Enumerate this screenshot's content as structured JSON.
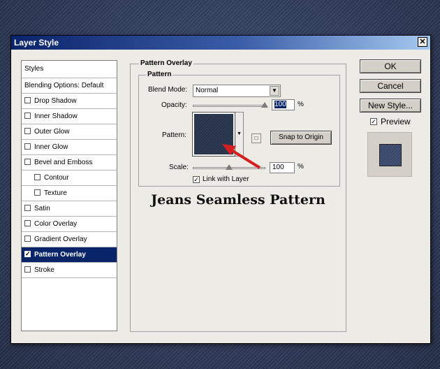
{
  "dialog": {
    "title": "Layer Style",
    "close_glyph": "✕"
  },
  "styles_list": {
    "items": [
      {
        "label": "Styles",
        "checkbox": false,
        "checked": false
      },
      {
        "label": "Blending Options: Default",
        "checkbox": false,
        "checked": false
      },
      {
        "label": "Drop Shadow",
        "checkbox": true,
        "checked": false
      },
      {
        "label": "Inner Shadow",
        "checkbox": true,
        "checked": false
      },
      {
        "label": "Outer Glow",
        "checkbox": true,
        "checked": false
      },
      {
        "label": "Inner Glow",
        "checkbox": true,
        "checked": false
      },
      {
        "label": "Bevel and Emboss",
        "checkbox": true,
        "checked": false
      },
      {
        "label": "Contour",
        "checkbox": true,
        "checked": false,
        "sub": true
      },
      {
        "label": "Texture",
        "checkbox": true,
        "checked": false,
        "sub": true
      },
      {
        "label": "Satin",
        "checkbox": true,
        "checked": false
      },
      {
        "label": "Color Overlay",
        "checkbox": true,
        "checked": false
      },
      {
        "label": "Gradient Overlay",
        "checkbox": true,
        "checked": false
      },
      {
        "label": "Pattern Overlay",
        "checkbox": true,
        "checked": true,
        "selected": true
      },
      {
        "label": "Stroke",
        "checkbox": true,
        "checked": false
      }
    ]
  },
  "pattern_overlay": {
    "group_title": "Pattern Overlay",
    "sub_group_title": "Pattern",
    "blend_mode_label": "Blend Mode:",
    "blend_mode_value": "Normal",
    "opacity_label": "Opacity:",
    "opacity_value": "100",
    "percent": "%",
    "pattern_label": "Pattern:",
    "snap_button": "Snap to Origin",
    "scale_label": "Scale:",
    "scale_value": "100",
    "link_label": "Link with Layer",
    "link_checked": true
  },
  "caption": "Jeans Seamless Pattern",
  "buttons": {
    "ok": "OK",
    "cancel": "Cancel",
    "new_style": "New Style...",
    "preview_label": "Preview",
    "preview_checked": true
  },
  "colors": {
    "selection": "#0a246a",
    "pattern_swatch": "#27324b",
    "arrow": "#d42020"
  }
}
